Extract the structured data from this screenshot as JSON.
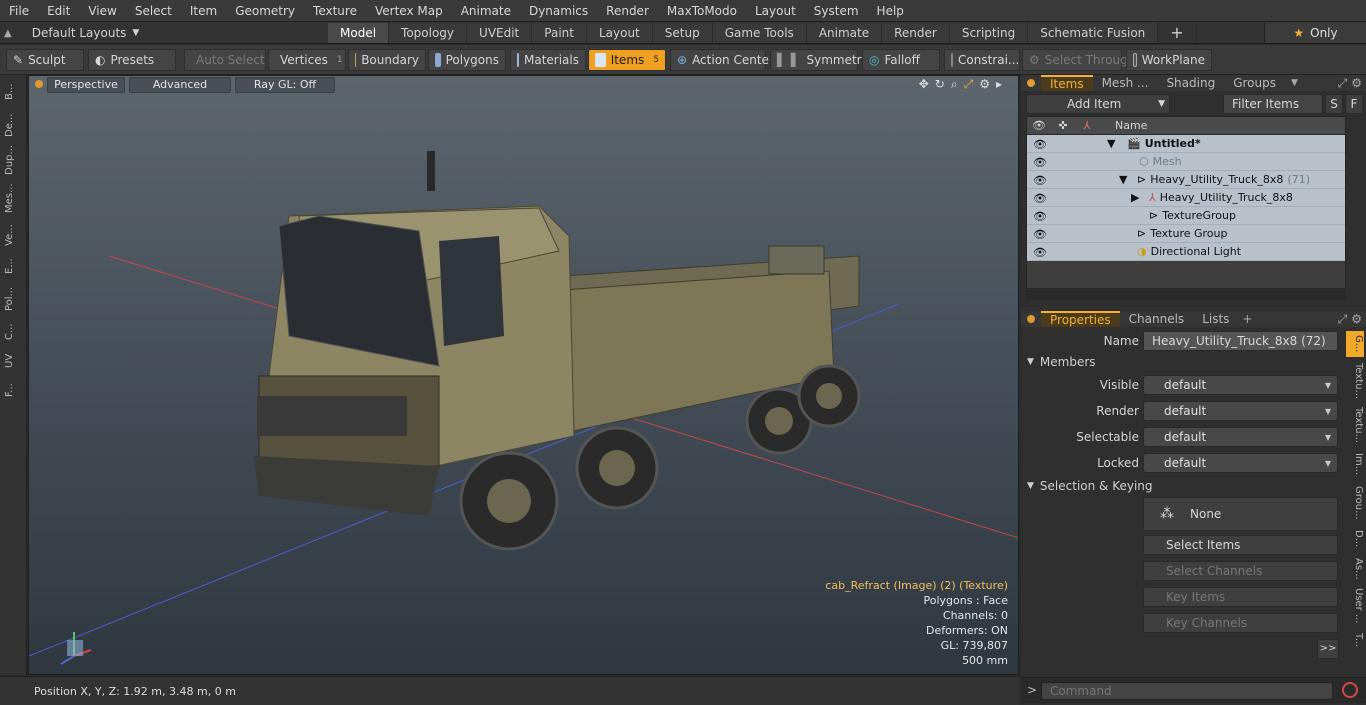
{
  "menu": [
    "File",
    "Edit",
    "View",
    "Select",
    "Item",
    "Geometry",
    "Texture",
    "Vertex Map",
    "Animate",
    "Dynamics",
    "Render",
    "MaxToModo",
    "Layout",
    "System",
    "Help"
  ],
  "layout": {
    "dropdown": "Default Layouts"
  },
  "tabs": [
    "Model",
    "Topology",
    "UVEdit",
    "Paint",
    "Layout",
    "Setup",
    "Game Tools",
    "Animate",
    "Render",
    "Scripting",
    "Schematic Fusion"
  ],
  "active_tab": "Model",
  "only_label": "Only",
  "toolbar": {
    "sculpt": "Sculpt",
    "presets": "Presets",
    "auto_select": "Auto Select",
    "vertices": "Vertices",
    "vertices_count": "1",
    "boundary": "Boundary",
    "polygons": "Polygons",
    "materials": "Materials",
    "items": "Items",
    "items_count": "5",
    "action_center": "Action Center",
    "symmetry": "Symmetry",
    "falloff": "Falloff",
    "constraints": "Constrai...",
    "select_through": "Select Through",
    "workplane": "WorkPlane"
  },
  "left_tabs": [
    "B...",
    "De...",
    "Dup...",
    "Mes...",
    "Ve...",
    "E...",
    "Pol...",
    "C...",
    "UV",
    "F..."
  ],
  "viewport": {
    "perspective": "Perspective",
    "advanced": "Advanced",
    "raygl": "Ray GL: Off",
    "info": {
      "texture": "cab_Refract (Image) (2) (Texture)",
      "polygons": "Polygons : Face",
      "channels": "Channels: 0",
      "deformers": "Deformers: ON",
      "gl": "GL: 739,807",
      "scale": "500 mm"
    }
  },
  "status": {
    "position": "Position X, Y, Z:   1.92 m, 3.48 m, 0 m"
  },
  "panel_tabs": [
    "Items",
    "Mesh ...",
    "Shading",
    "Groups"
  ],
  "add_item": "Add Item",
  "filter_items": "Filter Items",
  "filter_s": "S",
  "filter_f": "F",
  "tree": {
    "name_header": "Name",
    "rows": [
      {
        "label": "Untitled*"
      },
      {
        "label": "Mesh"
      },
      {
        "label": "Heavy_Utility_Truck_8x8",
        "count": "(71)"
      },
      {
        "label": "Heavy_Utility_Truck_8x8"
      },
      {
        "label": "TextureGroup"
      },
      {
        "label": "Texture Group"
      },
      {
        "label": "Directional Light"
      }
    ]
  },
  "props_tabs": [
    "Properties",
    "Channels",
    "Lists"
  ],
  "props": {
    "name_label": "Name",
    "name_value": "Heavy_Utility_Truck_8x8 (72)",
    "members": "Members",
    "visible_label": "Visible",
    "visible_value": "default",
    "render_label": "Render",
    "render_value": "default",
    "selectable_label": "Selectable",
    "selectable_value": "default",
    "locked_label": "Locked",
    "locked_value": "default",
    "sel_keying": "Selection & Keying",
    "none": "None",
    "select_items": "Select Items",
    "select_channels": "Select Channels",
    "key_items": "Key Items",
    "key_channels": "Key Channels",
    "more": ">>"
  },
  "right_tabs": [
    "G...",
    "Textu...",
    "Textu...",
    "Im...",
    "Grou...",
    "D...",
    "As...",
    "User ...",
    "T..."
  ],
  "command": {
    "placeholder": "Command"
  }
}
